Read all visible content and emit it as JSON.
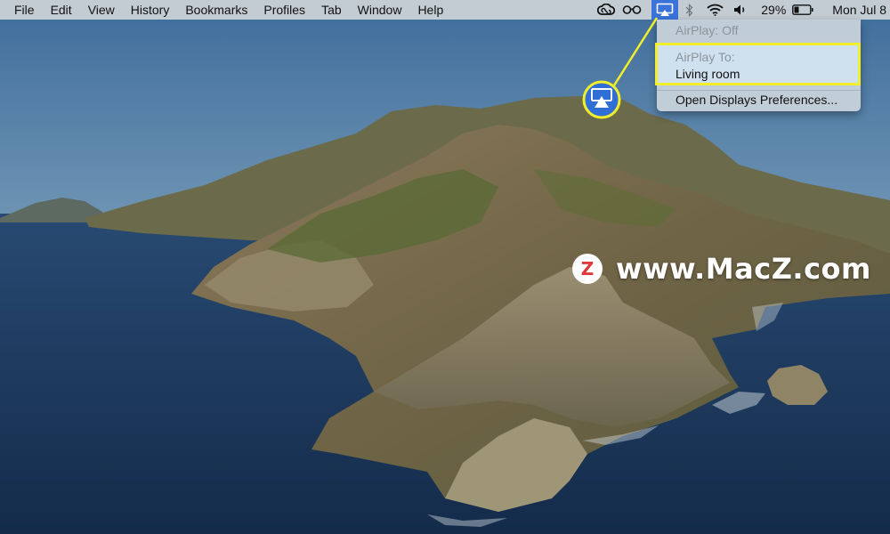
{
  "menubar": {
    "menus": [
      "File",
      "Edit",
      "View",
      "History",
      "Bookmarks",
      "Profiles",
      "Tab",
      "Window",
      "Help"
    ],
    "status": {
      "icons": [
        "creative-cloud-icon",
        "glasses-icon",
        "airplay-icon",
        "bluetooth-icon",
        "wifi-icon",
        "volume-icon",
        "battery-icon"
      ],
      "battery_percent": "29%",
      "clock": "Mon Jul 8"
    }
  },
  "airplay_menu": {
    "status": "AirPlay: Off",
    "airplay_to_label": "AirPlay To:",
    "device": "Living room",
    "preferences": "Open Displays Preferences..."
  },
  "callout": {
    "icon": "airplay-icon",
    "highlight_color": "#f2ee2b"
  },
  "watermark": {
    "text": "www.MacZ.com",
    "logo_letter": "Z",
    "logo_color": "#e23a3a"
  },
  "colors": {
    "menubar": "#c3ccd3",
    "airplay_active": "#3a73d9",
    "sea": "#1b3557",
    "sky": "#4a78a6"
  }
}
